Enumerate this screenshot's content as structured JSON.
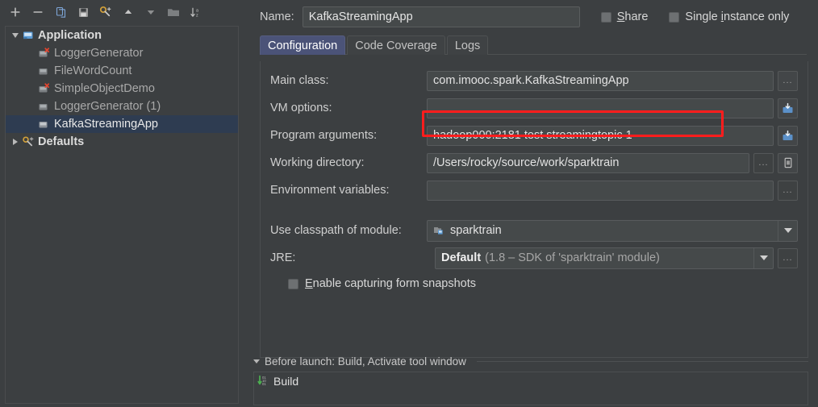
{
  "toolbar": {
    "buttons": [
      {
        "name": "add-button",
        "icon": "plus-icon",
        "title": "Add New Configuration"
      },
      {
        "name": "remove-button",
        "icon": "minus-icon",
        "title": "Remove Configuration"
      },
      {
        "name": "copy-button",
        "icon": "copy-icon",
        "title": "Copy Configuration"
      },
      {
        "name": "save-button",
        "icon": "save-icon",
        "title": "Save Configuration"
      },
      {
        "name": "edit-defaults-button",
        "icon": "wrench-icon",
        "title": "Edit defaults"
      },
      {
        "name": "move-up-button",
        "icon": "arrow-up-icon",
        "title": "Move Up"
      },
      {
        "name": "move-down-button",
        "icon": "arrow-down-icon",
        "title": "Move Down"
      },
      {
        "name": "new-folder-button",
        "icon": "folder-icon",
        "title": "Create New Folder"
      },
      {
        "name": "sort-button",
        "icon": "sort-alphabetical-icon",
        "title": "Sort Configurations"
      }
    ]
  },
  "tree": {
    "nodes": [
      {
        "label": "Application",
        "level": 0,
        "twisty": "open",
        "icon": "application-module-icon",
        "selected": false,
        "error": false,
        "bold": true
      },
      {
        "label": "LoggerGenerator",
        "level": 1,
        "twisty": "none",
        "icon": "run-config-icon",
        "selected": false,
        "error": true,
        "bold": false
      },
      {
        "label": "FileWordCount",
        "level": 1,
        "twisty": "none",
        "icon": "run-config-icon",
        "selected": false,
        "error": false,
        "bold": false
      },
      {
        "label": "SimpleObjectDemo",
        "level": 1,
        "twisty": "none",
        "icon": "run-config-icon",
        "selected": false,
        "error": true,
        "bold": false
      },
      {
        "label": "LoggerGenerator (1)",
        "level": 1,
        "twisty": "none",
        "icon": "run-config-icon",
        "selected": false,
        "error": false,
        "bold": false
      },
      {
        "label": "KafkaStreamingApp",
        "level": 1,
        "twisty": "none",
        "icon": "run-config-icon",
        "selected": true,
        "error": false,
        "bold": false
      },
      {
        "label": "Defaults",
        "level": 0,
        "twisty": "closed",
        "icon": "defaults-wrench-icon",
        "selected": false,
        "error": false,
        "bold": true
      }
    ]
  },
  "header": {
    "name_label": "Name:",
    "name_value": "KafkaStreamingApp",
    "share_label_prefix": "",
    "share_label_mnemonic": "S",
    "share_label_suffix": "hare",
    "single_prefix": "Single ",
    "single_mnemonic": "i",
    "single_suffix": "nstance only"
  },
  "tabs": [
    {
      "label": "Configuration",
      "active": true
    },
    {
      "label": "Code Coverage",
      "active": false
    },
    {
      "label": "Logs",
      "active": false
    }
  ],
  "form": {
    "main_class_label": "Main class:",
    "main_class_value": "com.imooc.spark.KafkaStreamingApp",
    "main_class_browse": "...",
    "vm_options_label": "VM options:",
    "vm_options_value": "",
    "program_arguments_label": "Program arguments:",
    "program_arguments_value": "hadoop000:2181 test streamingtopic 1",
    "working_directory_label": "Working directory:",
    "working_directory_value": "/Users/rocky/source/work/sparktrain",
    "working_directory_browse": "...",
    "environment_variables_label": "Environment variables:",
    "environment_variables_value": "",
    "environment_variables_browse": "...",
    "use_classpath_label": "Use classpath of module:",
    "use_classpath_value": "sparktrain",
    "jre_label": "JRE:",
    "jre_value_strong": "Default",
    "jre_value_dim": "(1.8 – SDK of 'sparktrain' module)",
    "jre_browse": "...",
    "enable_snapshots_mnemonic": "E",
    "enable_snapshots_label": "nable capturing form snapshots"
  },
  "before_launch": {
    "title": "Before launch: Build, Activate tool window",
    "items": [
      {
        "label": "Build",
        "icon": "compile-build-icon"
      }
    ]
  },
  "colors": {
    "background": "#3c3f41",
    "field_background": "#45494a",
    "selection": "#2e3c51",
    "active_tab": "#4b5378",
    "annotation_red": "#ff1d1d",
    "error_badge": "#e8442e",
    "build_green": "#4caf50",
    "text_primary": "#e2e2e2",
    "text_secondary": "#a9a9a9"
  }
}
